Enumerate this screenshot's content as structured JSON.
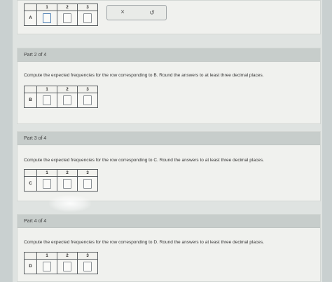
{
  "top_table": {
    "row_label": "A",
    "columns": [
      "1",
      "2",
      "3"
    ]
  },
  "toolbar": {
    "clear_symbol": "×",
    "undo_symbol": "↺",
    "clear_icon": "close-icon",
    "undo_icon": "undo-icon"
  },
  "parts": [
    {
      "header": "Part 2 of 4",
      "prompt": "Compute the expected frequencies for the row corresponding to B. Round the answers to at least three decimal places.",
      "row_label": "B",
      "columns": [
        "1",
        "2",
        "3"
      ]
    },
    {
      "header": "Part 3 of 4",
      "prompt": "Compute the expected frequencies for the row corresponding to C. Round the answers to at least three decimal places.",
      "row_label": "C",
      "columns": [
        "1",
        "2",
        "3"
      ]
    },
    {
      "header": "Part 4 of 4",
      "prompt": "Compute the expected frequencies for the row corresponding to D. Round the answers to at least three decimal places.",
      "row_label": "D",
      "columns": [
        "1",
        "2",
        "3"
      ]
    }
  ]
}
